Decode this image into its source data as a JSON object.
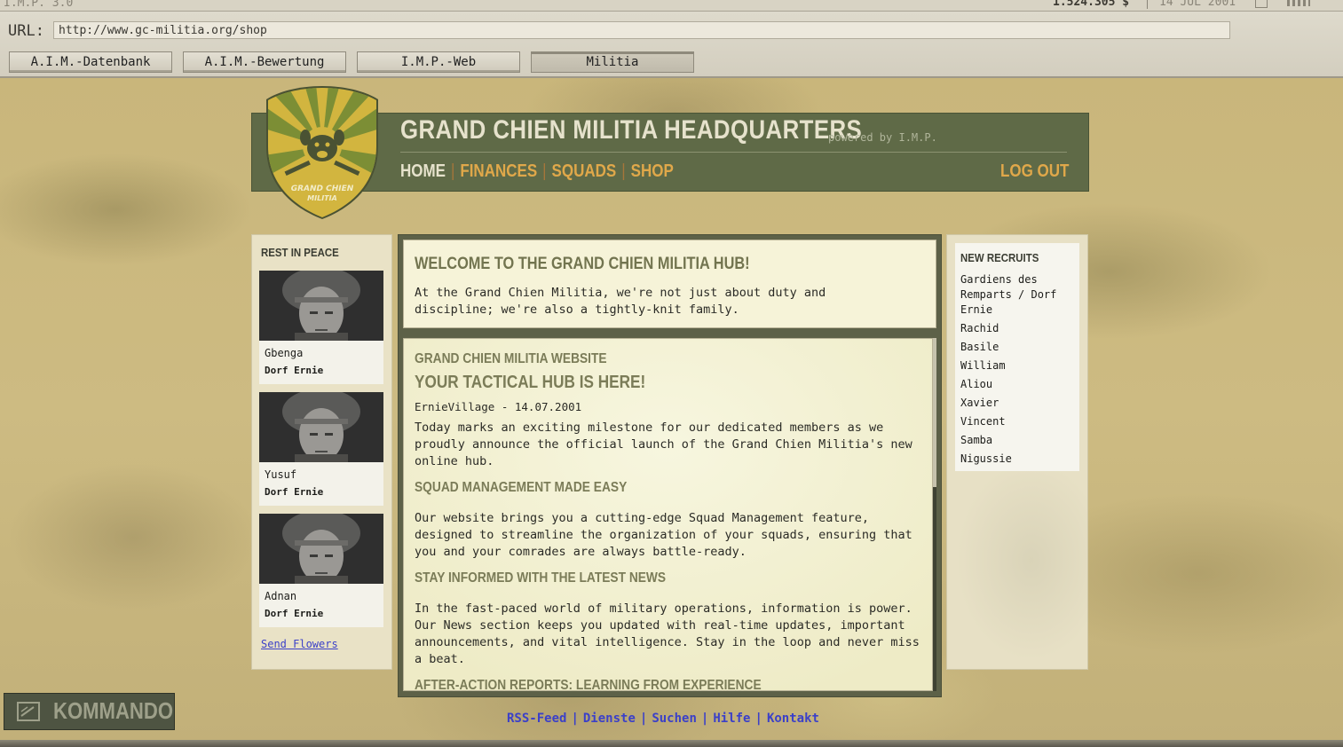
{
  "topbar": {
    "app_name": "I.M.P. 3.0",
    "money": "1.524.305 $",
    "date": "14 JUL 2001"
  },
  "browser": {
    "url_label": "URL:",
    "url": "http://www.gc-militia.org/shop",
    "tabs": [
      {
        "label": "A.I.M.-Datenbank",
        "active": false
      },
      {
        "label": "A.I.M.-Bewertung",
        "active": false
      },
      {
        "label": "I.M.P.-Web",
        "active": false
      },
      {
        "label": "Militia",
        "active": true
      }
    ]
  },
  "header": {
    "logo_text_line1": "GRAND CHIEN",
    "logo_text_line2": "MILITIA",
    "title": "GRAND CHIEN MILITIA HEADQUARTERS",
    "powered": "powered by I.M.P.",
    "nav": [
      "HOME",
      "FINANCES",
      "SQUADS",
      "SHOP"
    ],
    "logout": "LOG OUT",
    "accent_color": "#e0a84a",
    "header_color": "#5f6a47"
  },
  "rest_in_peace": {
    "title": "REST IN PEACE",
    "members": [
      {
        "name": "Gbenga",
        "location": "Dorf Ernie"
      },
      {
        "name": "Yusuf",
        "location": "Dorf Ernie"
      },
      {
        "name": "Adnan",
        "location": "Dorf Ernie"
      }
    ],
    "send_flowers": "Send Flowers"
  },
  "welcome": {
    "title": "WELCOME TO THE GRAND CHIEN MILITIA HUB!",
    "text": "At the Grand Chien Militia, we're not just about duty and discipline; we're also a tightly-knit family."
  },
  "article": {
    "kicker": "GRAND CHIEN MILITIA WEBSITE",
    "headline": "YOUR TACTICAL HUB IS HERE!",
    "byline": "ErnieVillage - 14.07.2001",
    "intro": "Today marks an exciting milestone for our dedicated members as we proudly announce the official launch of the Grand Chien Militia's new online hub.",
    "section1_title": "SQUAD MANAGEMENT MADE EASY",
    "section1_text": "Our website brings you a cutting-edge Squad Management feature, designed to streamline the organization of your squads, ensuring that you and your comrades are always battle-ready.",
    "section2_title": "STAY INFORMED WITH THE LATEST NEWS",
    "section2_text": "In the fast-paced world of military operations, information is power. Our News section keeps you updated with real-time updates, important announcements, and vital intelligence. Stay in the loop and never miss a beat.",
    "section3_title": "AFTER-ACTION REPORTS: LEARNING FROM EXPERIENCE"
  },
  "new_recruits": {
    "title": "NEW RECRUITS",
    "names": [
      "Gardiens des Remparts / Dorf Ernie",
      "Rachid",
      "Basile",
      "William",
      "Aliou",
      "Xavier",
      "Vincent",
      "Samba",
      "Nigussie"
    ]
  },
  "footer": {
    "links": [
      "RSS-Feed",
      "Dienste",
      "Suchen",
      "Hilfe",
      "Kontakt"
    ],
    "link_color": "#3b40c8"
  },
  "kommando": {
    "label": "KOMMANDO"
  }
}
